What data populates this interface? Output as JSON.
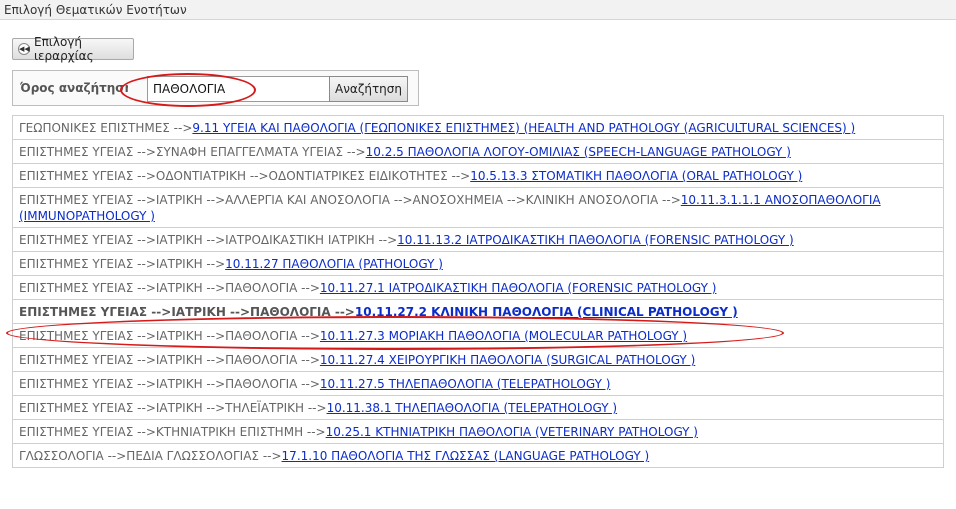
{
  "window": {
    "title": "Επιλογή Θεματικών Ενοτήτων"
  },
  "toolbar": {
    "hierarchy_label": "Επιλογή ιεραρχίας",
    "hierarchy_icon": "rewind-icon"
  },
  "search": {
    "label": "Όρος αναζήτησης:",
    "value": "ΠΑΘΟΛΟΓΙΑ",
    "button_label": "Αναζήτηση"
  },
  "results": [
    {
      "path": "ΓΕΩΠΟΝΙΚΕΣ ΕΠΙΣΤΗΜΕΣ -->",
      "link": "9.11 ΥΓΕΙΑ ΚΑΙ ΠΑΘΟΛΟΓΙΑ (ΓΕΩΠΟΝΙΚΕΣ ΕΠΙΣΤΗΜΕΣ) (HEALTH AND PATHOLOGY (AGRICULTURAL SCIENCES) )"
    },
    {
      "path": "ΕΠΙΣΤΗΜΕΣ ΥΓΕΙΑΣ -->ΣΥΝΑΦΗ ΕΠΑΓΓΕΛΜΑΤΑ ΥΓΕΙΑΣ -->",
      "link": "10.2.5 ΠΑΘΟΛΟΓΙΑ ΛΟΓΟΥ-ΟΜΙΛΙΑΣ (SPEECH-LANGUAGE PATHOLOGY )"
    },
    {
      "path": "ΕΠΙΣΤΗΜΕΣ ΥΓΕΙΑΣ -->ΟΔΟΝΤΙΑΤΡΙΚΗ -->ΟΔΟΝΤΙΑΤΡΙΚΕΣ ΕΙΔΙΚΟΤΗΤΕΣ -->",
      "link": "10.5.13.3 ΣΤΟΜΑΤΙΚΗ ΠΑΘΟΛΟΓΙΑ (ORAL PATHOLOGY )"
    },
    {
      "path": "ΕΠΙΣΤΗΜΕΣ ΥΓΕΙΑΣ -->ΙΑΤΡΙΚΗ -->ΑΛΛΕΡΓΙΑ ΚΑΙ ΑΝΟΣΟΛΟΓΙΑ -->ΑΝΟΣΟΧΗΜΕΙΑ -->ΚΛΙΝΙΚΗ ΑΝΟΣΟΛΟΓΙΑ -->",
      "link": "10.11.3.1.1.1 ΑΝΟΣΟΠΑΘΟΛΟΓΙΑ (IMMUNOPATHOLOGY )"
    },
    {
      "path": "ΕΠΙΣΤΗΜΕΣ ΥΓΕΙΑΣ -->ΙΑΤΡΙΚΗ -->ΙΑΤΡΟΔΙΚΑΣΤΙΚΗ ΙΑΤΡΙΚΗ -->",
      "link": "10.11.13.2 ΙΑΤΡΟΔΙΚΑΣΤΙΚΗ ΠΑΘΟΛΟΓΙΑ (FORENSIC PATHOLOGY )"
    },
    {
      "path": "ΕΠΙΣΤΗΜΕΣ ΥΓΕΙΑΣ -->ΙΑΤΡΙΚΗ -->",
      "link": "10.11.27 ΠΑΘΟΛΟΓΙΑ (PATHOLOGY )"
    },
    {
      "path": "ΕΠΙΣΤΗΜΕΣ ΥΓΕΙΑΣ -->ΙΑΤΡΙΚΗ -->ΠΑΘΟΛΟΓΙΑ -->",
      "link": "10.11.27.1 ΙΑΤΡΟΔΙΚΑΣΤΙΚΗ ΠΑΘΟΛΟΓΙΑ (FORENSIC PATHOLOGY )"
    },
    {
      "path": "ΕΠΙΣΤΗΜΕΣ ΥΓΕΙΑΣ -->ΙΑΤΡΙΚΗ -->ΠΑΘΟΛΟΓΙΑ -->",
      "link": "10.11.27.2 ΚΛΙΝΙΚΗ ΠΑΘΟΛΟΓΙΑ (CLINICAL PATHOLOGY )",
      "highlighted": true
    },
    {
      "path": "ΕΠΙΣΤΗΜΕΣ ΥΓΕΙΑΣ -->ΙΑΤΡΙΚΗ -->ΠΑΘΟΛΟΓΙΑ -->",
      "link": "10.11.27.3 ΜΟΡΙΑΚΗ ΠΑΘΟΛΟΓΙΑ (MOLECULAR PATHOLOGY )"
    },
    {
      "path": "ΕΠΙΣΤΗΜΕΣ ΥΓΕΙΑΣ -->ΙΑΤΡΙΚΗ -->ΠΑΘΟΛΟΓΙΑ -->",
      "link": "10.11.27.4 ΧΕΙΡΟΥΡΓΙΚΗ ΠΑΘΟΛΟΓΙΑ (SURGICAL PATHOLOGY )"
    },
    {
      "path": "ΕΠΙΣΤΗΜΕΣ ΥΓΕΙΑΣ -->ΙΑΤΡΙΚΗ -->ΠΑΘΟΛΟΓΙΑ -->",
      "link": "10.11.27.5 ΤΗΛΕΠΑΘΟΛΟΓΙΑ (TELEPATHOLOGY )"
    },
    {
      "path": "ΕΠΙΣΤΗΜΕΣ ΥΓΕΙΑΣ -->ΙΑΤΡΙΚΗ -->ΤΗΛΕΪΑΤΡΙΚΗ -->",
      "link": "10.11.38.1 ΤΗΛΕΠΑΘΟΛΟΓΙΑ (TELEPATHOLOGY )"
    },
    {
      "path": "ΕΠΙΣΤΗΜΕΣ ΥΓΕΙΑΣ -->ΚΤΗΝΙΑΤΡΙΚΗ ΕΠΙΣΤΗΜΗ -->",
      "link": "10.25.1 ΚΤΗΝΙΑΤΡΙΚΗ ΠΑΘΟΛΟΓΙΑ (VETERINARY PATHOLOGY )"
    },
    {
      "path": "ΓΛΩΣΣΟΛΟΓΙΑ -->ΠΕΔΙΑ ΓΛΩΣΣΟΛΟΓΙΑΣ -->",
      "link": "17.1.10 ΠΑΘΟΛΟΓΙΑ ΤΗΣ ΓΛΩΣΣΑΣ (LANGUAGE PATHOLOGY )"
    }
  ],
  "colors": {
    "link": "#0b2cc9",
    "annotation": "#d61a1a",
    "path_text": "#666666"
  }
}
